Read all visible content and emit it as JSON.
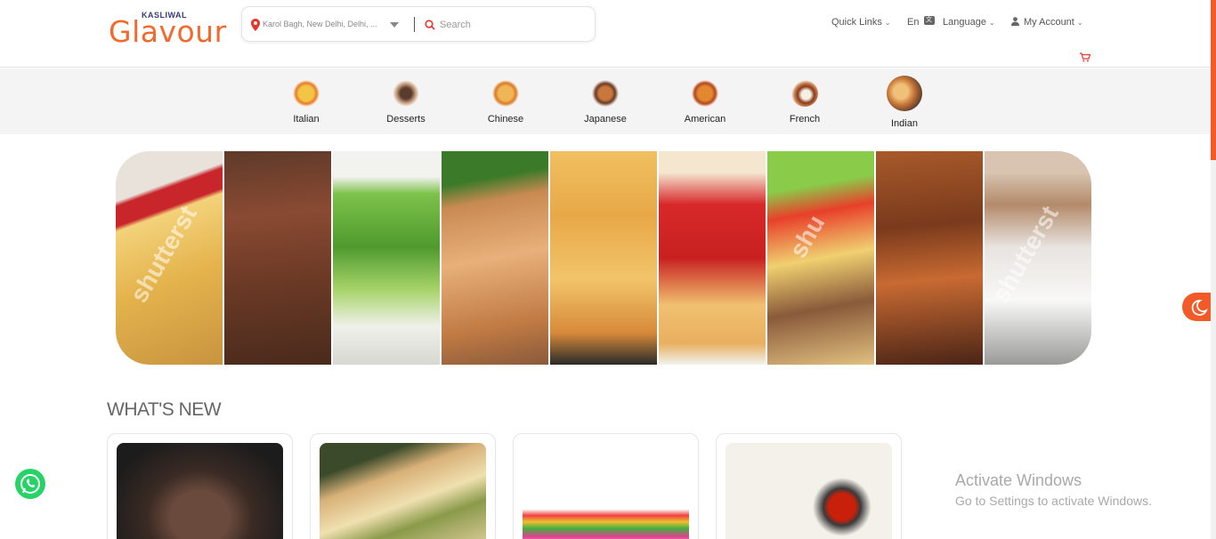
{
  "header": {
    "logo_super": "KASLIWAL",
    "logo_main": "Glavour",
    "location": "Karol Bagh, New Delhi, Delhi, ...",
    "search_placeholder": "Search",
    "nav": {
      "quick_links": "Quick Links",
      "lang_code": "En",
      "language": "Language",
      "my_account": "My Account"
    }
  },
  "categories": [
    {
      "label": "Italian",
      "color": "#e8a23a"
    },
    {
      "label": "Desserts",
      "color": "#8a6a55"
    },
    {
      "label": "Chinese",
      "color": "#e59a3b"
    },
    {
      "label": "Japanese",
      "color": "#b26b3c"
    },
    {
      "label": "American",
      "color": "#d46a2a"
    },
    {
      "label": "French",
      "color": "#8b4a2c"
    },
    {
      "label": "Indian",
      "color": "#c98b4a"
    }
  ],
  "whats_new": {
    "title": "WHAT'S NEW"
  },
  "windows_notice": {
    "title": "Activate Windows",
    "subtitle": "Go to Settings to activate Windows."
  },
  "colors": {
    "brand": "#f26a2e",
    "accent": "#f25a28",
    "whatsapp": "#25d366"
  }
}
